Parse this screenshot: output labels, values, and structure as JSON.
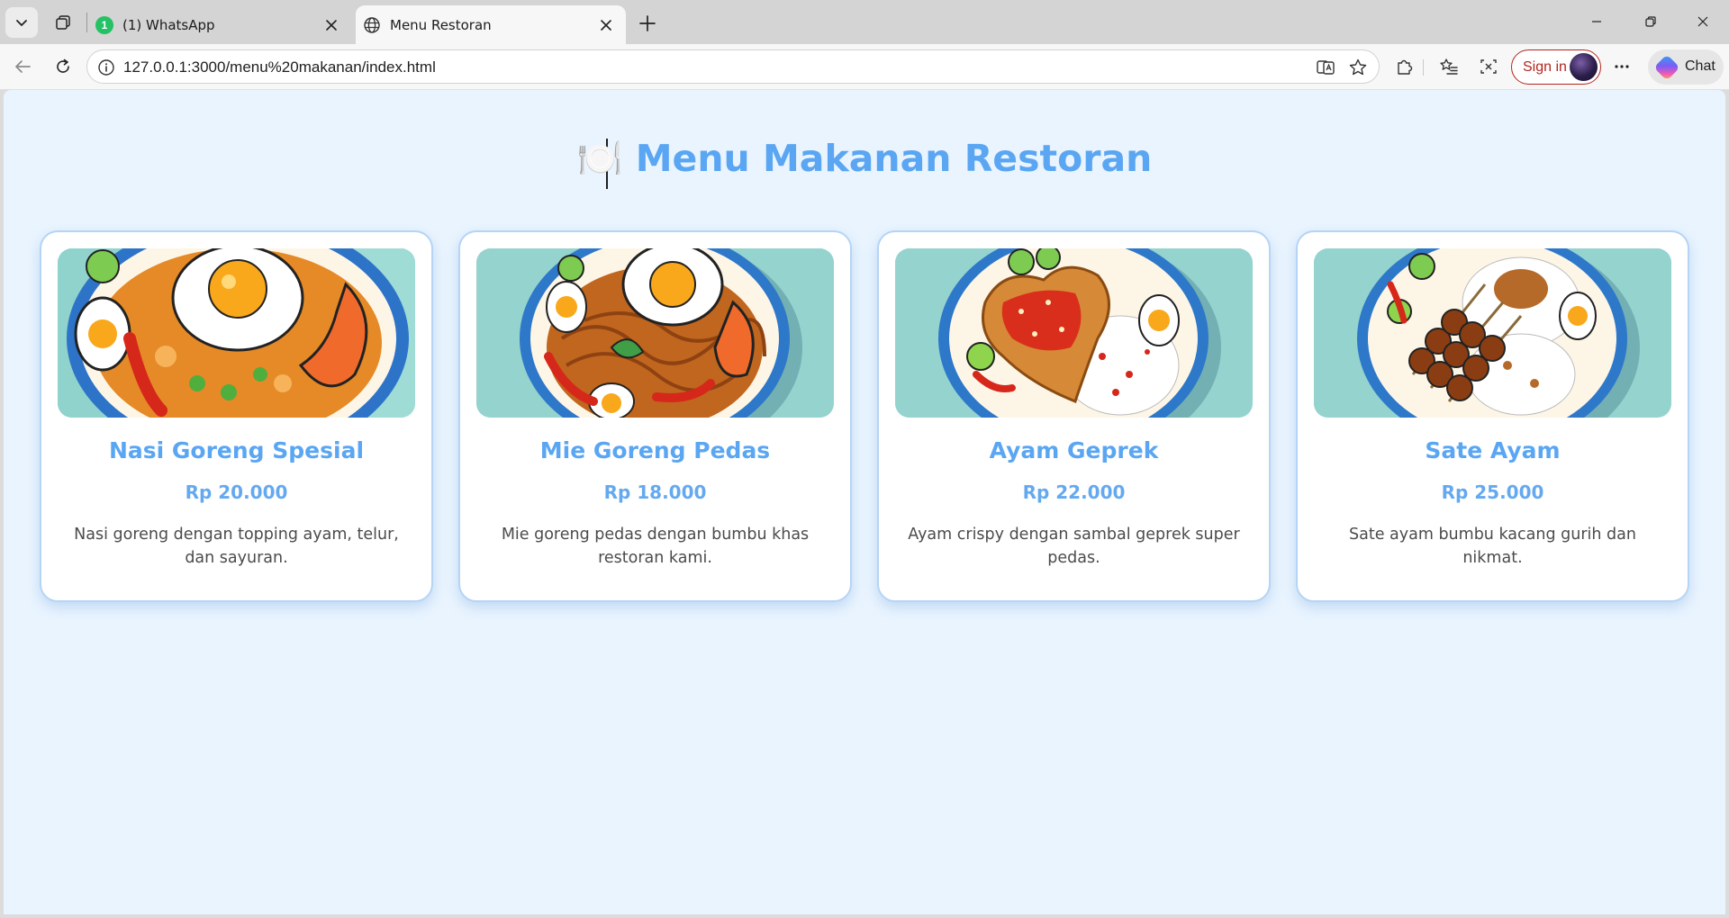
{
  "browser": {
    "tabs": [
      {
        "title": "(1) WhatsApp",
        "badge": "1"
      },
      {
        "title": "Menu Restoran"
      }
    ],
    "url": "127.0.0.1:3000/menu%20makanan/index.html",
    "signin_label": "Sign in",
    "chat_label": "Chat"
  },
  "page": {
    "title_icon": "🍽️",
    "title": "Menu Makanan Restoran",
    "menu": [
      {
        "name": "Nasi Goreng Spesial",
        "price": "Rp 20.000",
        "description": "Nasi goreng dengan topping ayam, telur, dan sayuran.",
        "image_icon": "fried-rice-illustration"
      },
      {
        "name": "Mie Goreng Pedas",
        "price": "Rp 18.000",
        "description": "Mie goreng pedas dengan bumbu khas restoran kami.",
        "image_icon": "fried-noodles-illustration"
      },
      {
        "name": "Ayam Geprek",
        "price": "Rp 22.000",
        "description": "Ayam crispy dengan sambal geprek super pedas.",
        "image_icon": "smashed-chicken-illustration"
      },
      {
        "name": "Sate Ayam",
        "price": "Rp 25.000",
        "description": "Sate ayam bumbu kacang gurih dan nikmat.",
        "image_icon": "chicken-satay-illustration"
      }
    ]
  },
  "colors": {
    "page_background": "#e9f4fe",
    "accent": "#5aa6f3",
    "card_border": "#b5d4f6",
    "image_background": "#95d3cf",
    "signin_red": "#b3261e"
  }
}
